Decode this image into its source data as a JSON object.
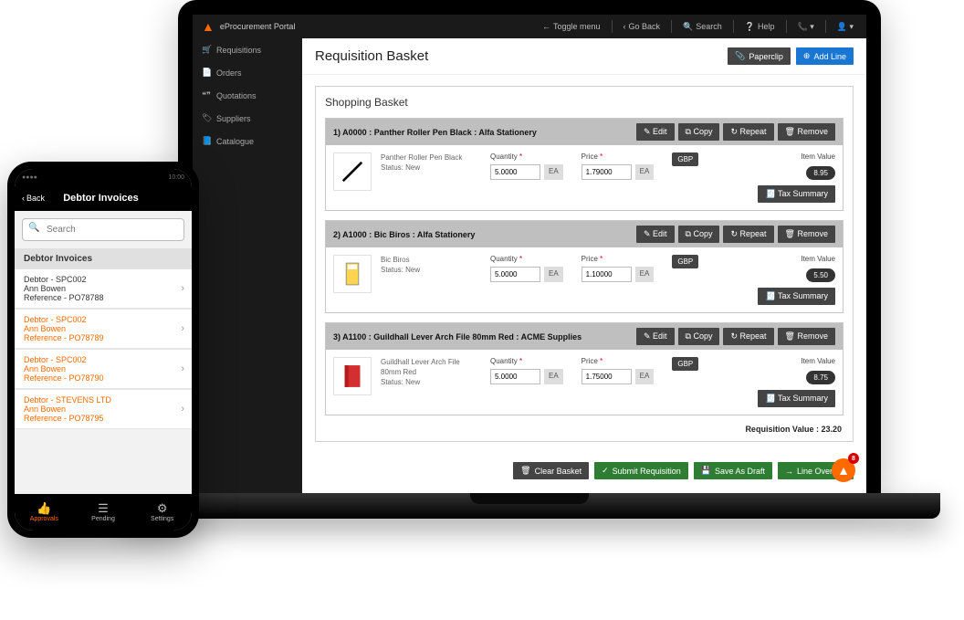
{
  "topbar": {
    "app_name": "eProcurement Portal",
    "toggle_menu": "Toggle menu",
    "go_back": "Go Back",
    "search": "Search",
    "help": "Help"
  },
  "sidebar": {
    "items": [
      {
        "icon": "🛒",
        "label": "Requisitions"
      },
      {
        "icon": "📄",
        "label": "Orders"
      },
      {
        "icon": "❝❞",
        "label": "Quotations"
      },
      {
        "icon": "🏷",
        "label": "Suppliers"
      },
      {
        "icon": "📘",
        "label": "Catalogue"
      }
    ]
  },
  "page": {
    "title": "Requisition Basket",
    "paperclip_label": "Paperclip",
    "add_line_label": "Add Line"
  },
  "basket": {
    "heading": "Shopping Basket",
    "actions": {
      "edit": "Edit",
      "copy": "Copy",
      "repeat": "Repeat",
      "remove": "Remove",
      "tax_summary": "Tax Summary"
    },
    "labels": {
      "quantity": "Quantity",
      "price": "Price",
      "req": "*",
      "unit": "EA",
      "item_value": "Item Value"
    },
    "currency": "GBP",
    "items": [
      {
        "num": "1",
        "code": "A0000",
        "name": "Panther Roller Pen Black",
        "supplier": "Alfa Stationery",
        "status": "Status: New",
        "qty": "5.0000",
        "price": "1.79000",
        "value": "8.95"
      },
      {
        "num": "2",
        "code": "A1000",
        "name": "Bic Biros",
        "supplier": "Alfa Stationery",
        "status": "Status: New",
        "qty": "5.0000",
        "price": "1.10000",
        "value": "5.50"
      },
      {
        "num": "3",
        "code": "A1100",
        "name": "Guildhall Lever Arch File 80mm Red",
        "supplier": "ACME Supplies",
        "status": "Status: New",
        "qty": "5.0000",
        "price": "1.75000",
        "value": "8.75"
      }
    ],
    "req_value_label": "Requisition Value :",
    "req_value": "23.20",
    "footer": {
      "clear": "Clear Basket",
      "submit": "Submit Requisition",
      "save": "Save As Draft",
      "override": "Line Override"
    },
    "fab_count": "8"
  },
  "phone": {
    "status_time": "10:00",
    "back": "Back",
    "title": "Debtor Invoices",
    "search_placeholder": "Search",
    "section": "Debtor Invoices",
    "rows": [
      {
        "debtor": "Debtor - SPC002",
        "person": "Ann Bowen",
        "ref": "Reference - PO78788",
        "highlight": false
      },
      {
        "debtor": "Debtor - SPC002",
        "person": "Ann Bowen",
        "ref": "Reference - PO78789",
        "highlight": true
      },
      {
        "debtor": "Debtor - SPC002",
        "person": "Ann Bowen",
        "ref": "Reference - PO78790",
        "highlight": true
      },
      {
        "debtor": "Debtor - STEVENS LTD",
        "person": "Ann Bowen",
        "ref": "Reference - PO78795",
        "highlight": true
      }
    ],
    "nav": {
      "approvals": "Approvals",
      "pending": "Pending",
      "settings": "Settings"
    }
  }
}
